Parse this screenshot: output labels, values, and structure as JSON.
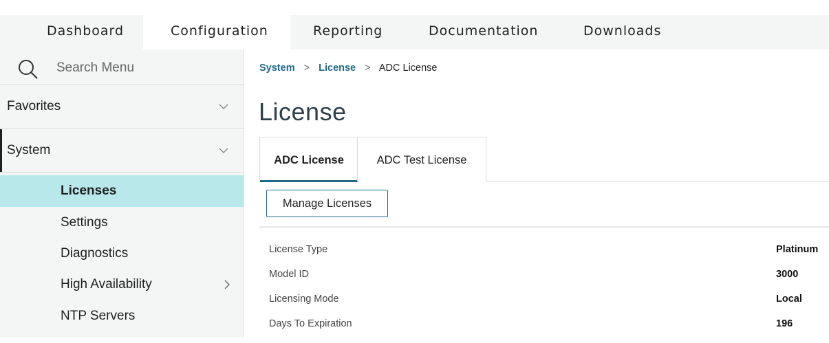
{
  "topnav": {
    "tabs": [
      {
        "label": "Dashboard"
      },
      {
        "label": "Configuration"
      },
      {
        "label": "Reporting"
      },
      {
        "label": "Documentation"
      },
      {
        "label": "Downloads"
      }
    ],
    "active_tab": "Configuration"
  },
  "sidebar": {
    "search": {
      "placeholder": "Search Menu",
      "icon": "search-icon"
    },
    "groups": [
      {
        "label": "Favorites",
        "expanded": false
      },
      {
        "label": "System",
        "expanded": true
      }
    ],
    "system_items": [
      {
        "label": "Licenses",
        "active": true
      },
      {
        "label": "Settings"
      },
      {
        "label": "Diagnostics"
      },
      {
        "label": "High Availability",
        "has_submenu": true
      },
      {
        "label": "NTP Servers"
      }
    ]
  },
  "main": {
    "breadcrumb": [
      {
        "label": "System"
      },
      {
        "label": "License"
      },
      {
        "label": "ADC License"
      }
    ],
    "title": "License",
    "tabs": [
      {
        "label": "ADC License",
        "active": true
      },
      {
        "label": "ADC Test License"
      }
    ],
    "manage_button": "Manage Licenses",
    "details": [
      {
        "key": "License Type",
        "value": "Platinum"
      },
      {
        "key": "Model ID",
        "value": "3000"
      },
      {
        "key": "Licensing Mode",
        "value": "Local"
      },
      {
        "key": "Days To Expiration",
        "value": "196"
      }
    ]
  },
  "colors": {
    "accent": "#1e6a86",
    "active_item_bg": "#b9e8ea",
    "sidebar_bg": "#f4f5f5",
    "title": "#2d3f48"
  }
}
